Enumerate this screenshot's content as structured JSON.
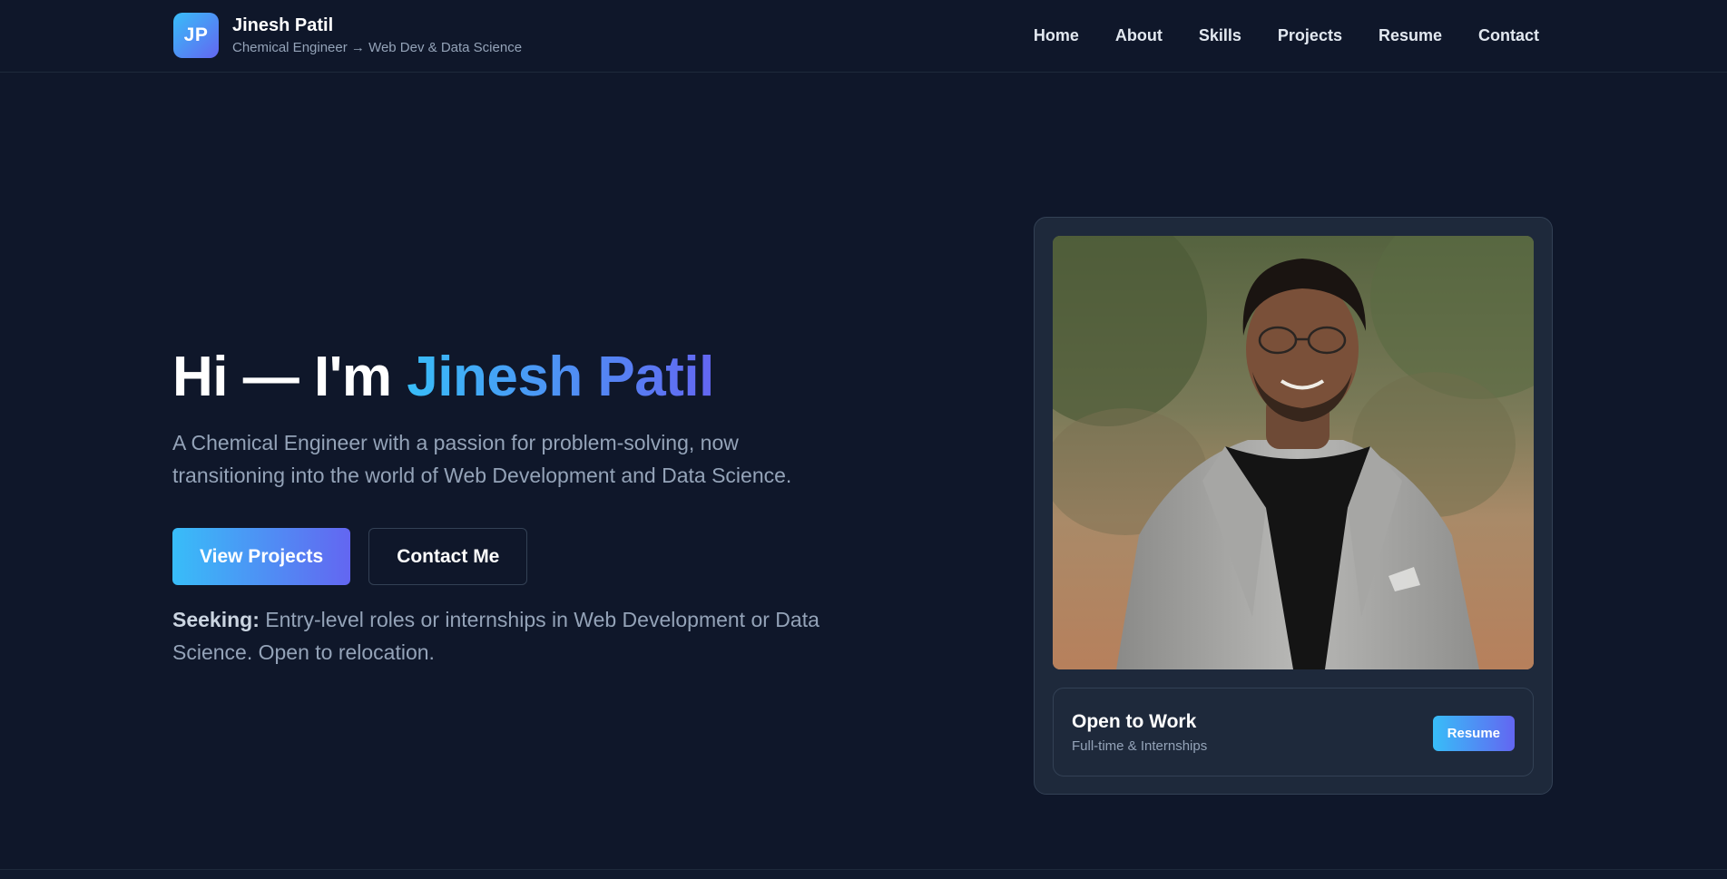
{
  "header": {
    "logo_text": "JP",
    "name": "Jinesh Patil",
    "tagline": "Chemical Engineer → Web Dev & Data Science",
    "nav": [
      "Home",
      "About",
      "Skills",
      "Projects",
      "Resume",
      "Contact"
    ]
  },
  "hero": {
    "title_prefix": "Hi — I'm ",
    "title_name": "Jinesh Patil",
    "subtitle": "A Chemical Engineer with a passion for problem-solving, now transitioning into the world of Web Development and Data Science.",
    "primary_button": "View Projects",
    "secondary_button": "Contact Me",
    "seeking_label": "Seeking:",
    "seeking_text": " Entry-level roles or internships in Web Development or Data Science. Open to relocation."
  },
  "profile_card": {
    "status_title": "Open to Work",
    "status_subtitle": "Full-time & Internships",
    "resume_button": "Resume"
  },
  "colors": {
    "background": "#0f172a",
    "accent_start": "#38bdf8",
    "accent_end": "#6366f1",
    "muted_text": "#94a3b8",
    "card_bg": "#1e293b"
  }
}
